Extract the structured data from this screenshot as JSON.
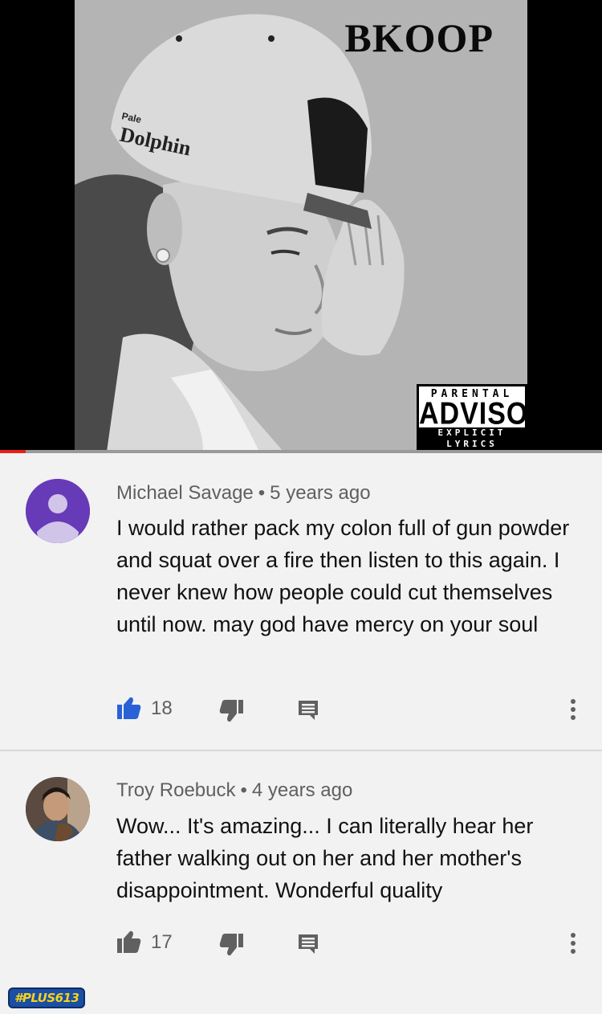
{
  "video": {
    "cover_title": "BKOOP",
    "cap_text": "Pale Dolphin",
    "advisory": {
      "top": "PARENTAL",
      "middle": "ADVISORY",
      "bottom": "EXPLICIT LYRICS"
    },
    "progress": 0.043,
    "progress_color": "#e62117"
  },
  "comments": [
    {
      "author": "Michael Savage",
      "separator": "•",
      "time": "5 years ago",
      "text": "I would rather pack my colon full of gun powder and squat over a fire then listen to this again. I never knew how people could cut themselves until now. may god have mercy on your soul",
      "likes": "18",
      "liked": true,
      "avatar_color": "#673ab7",
      "avatar_icon": "default-person-icon"
    },
    {
      "author": "Troy Roebuck",
      "separator": "•",
      "time": "4 years ago",
      "text": "Wow... It's amazing... I can literally hear her father walking out on her and her mother's disappointment. Wonderful quality",
      "likes": "17",
      "liked": false,
      "avatar_icon": "profile-photo"
    }
  ],
  "colors": {
    "like_active": "#2962d6",
    "icon_gray": "#606060",
    "author_gray": "#606060"
  },
  "watermark": "#PLUS613"
}
